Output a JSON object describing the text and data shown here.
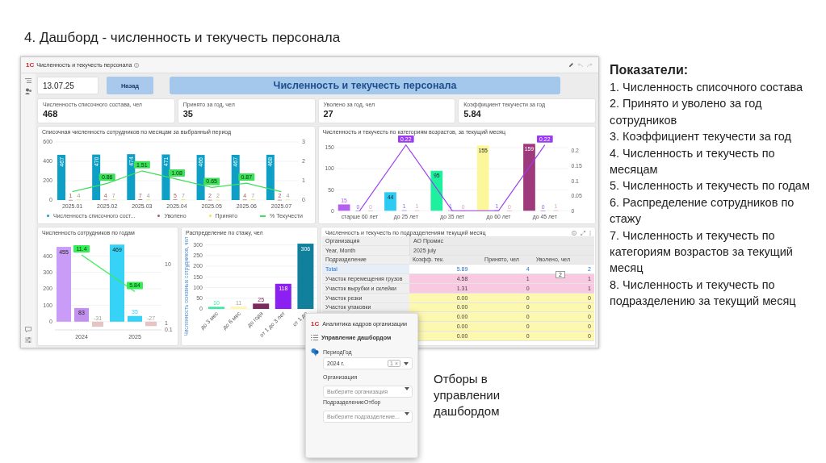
{
  "slide": {
    "title": "4. Дашборд - численность и текучесть персонала"
  },
  "dashboard": {
    "logo": "1С",
    "window_title": "Численность и текучесть персонала",
    "date": "13.07.25",
    "back_button": "Назад",
    "banner": "Численность и текучесть персонала",
    "kpis": [
      {
        "label": "Численность списочного состава, чел",
        "value": "468"
      },
      {
        "label": "Принято за год, чел",
        "value": "35"
      },
      {
        "label": "Уволено за год, чел",
        "value": "27"
      },
      {
        "label": "Коэффициент текучести за год",
        "value": "5.84"
      }
    ],
    "charts": [
      {
        "title": "Списочная численность сотрудников по месяцам за выбранный период",
        "legend": true,
        "chart_data": {
          "type": "bar",
          "grid": true,
          "categories": [
            "2025.01",
            "2025.02",
            "2025.03",
            "2025.04",
            "2025.05",
            "2025.06",
            "2025.07"
          ],
          "ylim": [
            0,
            600
          ],
          "yticks": [
            0,
            200,
            400,
            600
          ],
          "y2lim": [
            0,
            3
          ],
          "y2ticks": [
            0,
            1,
            2,
            3
          ],
          "data_labels": true,
          "series": [
            {
              "name": "Численность списочного сост...",
              "color": "#0e9fc6",
              "values": [
                467,
                470,
                474,
                471,
                466,
                467,
                468
              ],
              "value_labels": [
                "467",
                "470",
                "474",
                "471",
                "466",
                "467",
                "468"
              ]
            },
            {
              "name": "Уволено",
              "color": "#a85a5a",
              "values": [
                1,
                4,
                7,
                5,
                2,
                4,
                2
              ],
              "value_labels": [
                "1",
                "4",
                "7",
                "5",
                "2",
                "4",
                "2"
              ]
            },
            {
              "name": "Принято",
              "color": "#f2e24a",
              "values": [
                4,
                7,
                4,
                7,
                2,
                7,
                4
              ],
              "value_labels": [
                "4",
                "7",
                "4",
                "7",
                "2",
                "7",
                "4"
              ]
            },
            {
              "name": "% Текучести",
              "type": "line",
              "axis": "y2",
              "color": "#3ee05a",
              "values": [
                0.43,
                0.86,
                1.51,
                1.08,
                0.65,
                0.87,
                0.43
              ],
              "value_labels": [
                null,
                "0.86",
                "1.51",
                "1.08",
                "0.65",
                "0.87",
                null
              ]
            }
          ]
        }
      },
      {
        "title": "Численность и текучесть по категориям возрастов, за текущий месяц",
        "chart_data": {
          "type": "bar",
          "grid": true,
          "categories": [
            "старше 60 лет",
            "до 25 лет",
            "до 35 лет",
            "до 60 лет",
            "до 45 лет"
          ],
          "ylim": [
            0,
            160
          ],
          "yticks": [
            0,
            50,
            100,
            150
          ],
          "y2lim": [
            0,
            0.225
          ],
          "y2ticks": [
            0,
            0.05,
            0.1,
            0.15,
            0.2
          ],
          "data_labels": true,
          "series": [
            {
              "colors": [
                "#b45ef2",
                "#2ccbf2",
                "#1ef0a0",
                "#fdf79c",
                "#9e3a7c"
              ],
              "values": [
                15,
                44,
                95,
                155,
                159
              ],
              "value_labels": [
                "15",
                "44",
                "95",
                "155",
                "159"
              ]
            },
            {
              "color": "#8a6ee0",
              "values": [
                0,
                1,
                1,
                1,
                0
              ],
              "value_labels": [
                "0",
                "1",
                "1",
                "1",
                "0"
              ]
            },
            {
              "color": "#d8a8a8",
              "values": [
                0,
                1,
                0,
                0,
                1
              ],
              "value_labels": [
                "0",
                "1",
                "0",
                "0",
                "1"
              ]
            },
            {
              "type": "line",
              "axis": "y2",
              "color": "#9a3cf0",
              "values": [
                0,
                0.22,
                0,
                0,
                0.22
              ],
              "value_labels": [
                null,
                "0.22",
                null,
                null,
                "0.22"
              ]
            }
          ]
        }
      },
      {
        "title": "Численность сотрудников по годам",
        "chart_data": {
          "type": "bar",
          "grid": true,
          "categories": [
            "2024",
            "2025"
          ],
          "ylim": [
            -50,
            470
          ],
          "yticks": [
            0,
            100,
            200,
            300,
            400
          ],
          "y2lim": [
            0,
            13
          ],
          "y2ticks": [
            0.1,
            1,
            10
          ],
          "data_labels": true,
          "series": [
            {
              "colors": [
                "#c99cf7",
                "#37d3f7"
              ],
              "values": [
                455,
                469
              ],
              "value_labels": [
                "455",
                "469"
              ]
            },
            {
              "colors": [
                "#c290ef",
                "#37d3f7"
              ],
              "values": [
                83,
                35
              ],
              "value_labels": [
                "83",
                "35"
              ]
            },
            {
              "color": "#e6c4c4",
              "values": [
                -31,
                -27
              ],
              "value_labels": [
                "-31",
                "-27"
              ]
            },
            {
              "type": "line",
              "axis": "y2",
              "color": "#33ee55",
              "values": [
                11.4,
                5.84
              ],
              "value_labels": [
                "11.4",
                "5.84"
              ]
            }
          ]
        }
      },
      {
        "title": "Распределение по стажу, чел",
        "chart_data": {
          "type": "bar",
          "grid": true,
          "categories": [
            "до 3 мес",
            "до 6 мес",
            "до года",
            "от 1 до 3 лет",
            "от 1 до"
          ],
          "ylabel": "Численность основных сотрудников, чел",
          "ylim": [
            0,
            310
          ],
          "yticks": [
            0,
            50,
            100,
            150,
            200,
            250,
            300
          ],
          "data_labels": true,
          "series": [
            {
              "colors": [
                "#3ceaa8",
                "#fdf7b0",
                "#7d2b5e",
                "#8c1ff2",
                "#11809c"
              ],
              "values": [
                10,
                11,
                25,
                118,
                306
              ],
              "value_labels": [
                "10",
                "11",
                "25",
                "118",
                "306"
              ]
            }
          ]
        }
      }
    ],
    "table": {
      "title": "Численность и текучесть по подразделениям текущий месяц",
      "meta": [
        {
          "label": "Организация",
          "value": "АО Промис"
        },
        {
          "label": "Year, Month",
          "value": "2025 july"
        }
      ],
      "columns": [
        "Подразделение",
        "Коэфф. тек.",
        "Принято, чел",
        "Уволено, чел"
      ],
      "rows": [
        {
          "kind": "total",
          "cells": [
            "Total",
            "5.89",
            "4",
            "2"
          ]
        },
        {
          "kind": "data",
          "color": "#f9c9e2",
          "cells": [
            "Участок перемещения грузов",
            "4.58",
            "1",
            "1"
          ]
        },
        {
          "kind": "data",
          "color": "#f9c9e2",
          "cells": [
            "Участок вырубки и склейки",
            "1.31",
            "0",
            "1"
          ]
        },
        {
          "kind": "data",
          "color": "#fdf8b0",
          "cells": [
            "Участок резки",
            "0.00",
            "0",
            "0"
          ]
        },
        {
          "kind": "data",
          "color": "#fdf8b0",
          "cells": [
            "Участок упаковки",
            "0.00",
            "0",
            "0"
          ]
        },
        {
          "kind": "data",
          "color": "#fdf8b0",
          "cells": [
            "",
            "0.00",
            "0",
            "0"
          ]
        },
        {
          "kind": "data",
          "color": "#fdf8b0",
          "cells": [
            "",
            "0.00",
            "0",
            "0"
          ]
        },
        {
          "kind": "data",
          "color": "#fdf8b0",
          "cells": [
            "",
            "0.00",
            "0",
            "0"
          ]
        }
      ],
      "tooltip": "2"
    }
  },
  "filter_popup": {
    "logo": "1С",
    "title": "Аналитика кадров организации",
    "section": "Управление дашбордом",
    "fields": [
      {
        "label": "ПериодГод",
        "value": "2024 г.",
        "count": "1",
        "clear": "×"
      },
      {
        "label": "Организация",
        "placeholder": "Выберите организация"
      },
      {
        "label": "ПодразделениеОтбор",
        "placeholder": "Выберите подразделение..."
      }
    ]
  },
  "note": "Отборы в управлении дашбордом",
  "indicators": {
    "title": "Показатели:",
    "items": [
      "1. Численность списочного состава",
      "2. Принято и уволено за год сотрудников",
      "3. Коэффициент текучести за год",
      "4. Численность и текучесть по месяцам",
      "5. Численность и текучесть по годам",
      "6. Распределение сотрудников по стажу",
      "7. Численность и текучесть по категориям возрастов за текущий месяц",
      "8. Численность и текучесть по подразделению за текущий месяц"
    ]
  }
}
